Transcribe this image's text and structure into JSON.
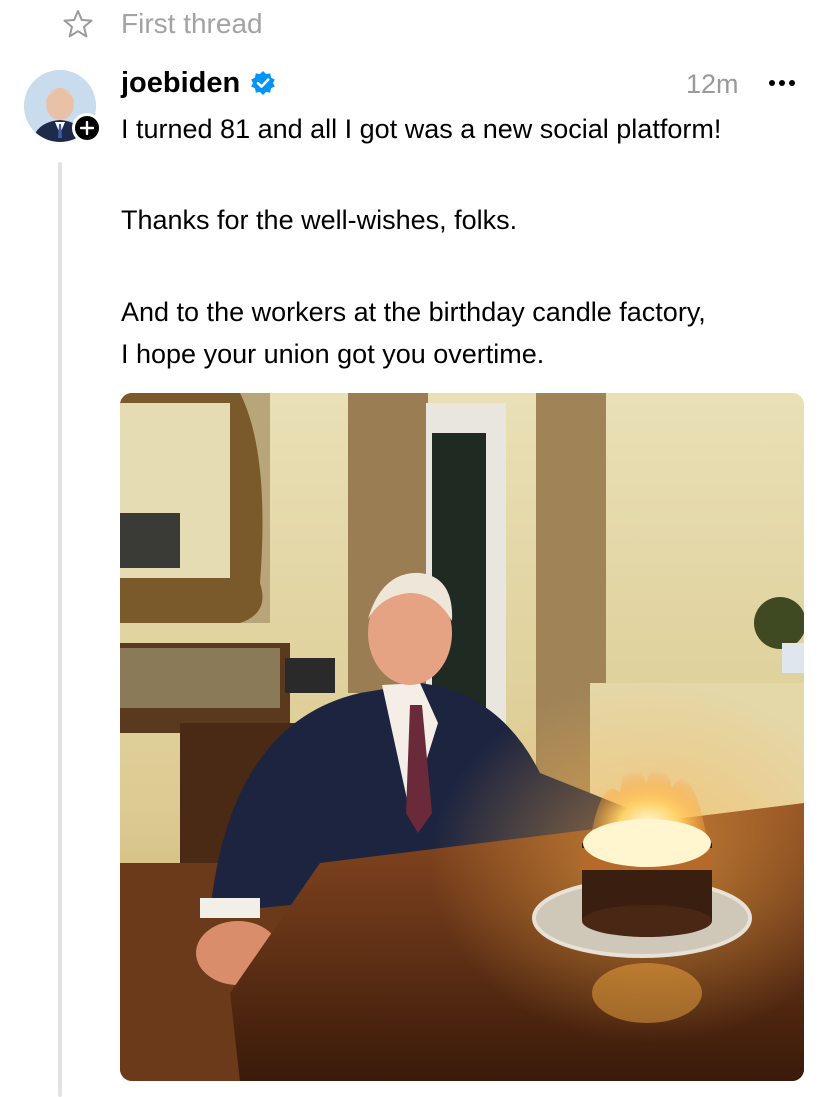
{
  "header": {
    "star_icon": "star-outline-icon",
    "title": "First thread"
  },
  "post": {
    "author": {
      "username": "joebiden",
      "verified_icon": "verified-badge-icon",
      "follow_icon": "plus-icon"
    },
    "timestamp": "12m",
    "more_icon": "more-horizontal-icon",
    "text_lines": [
      "I turned 81 and all I got was a new social platform!",
      "Thanks for the well-wishes, folks.",
      "And to the workers at the birthday candle factory,",
      "I hope your union got you overtime."
    ],
    "media": {
      "type": "photo"
    }
  },
  "colors": {
    "muted_text": "#9a9a9a",
    "verified_blue": "#0095f6",
    "thread_line": "#e3e3e3"
  }
}
